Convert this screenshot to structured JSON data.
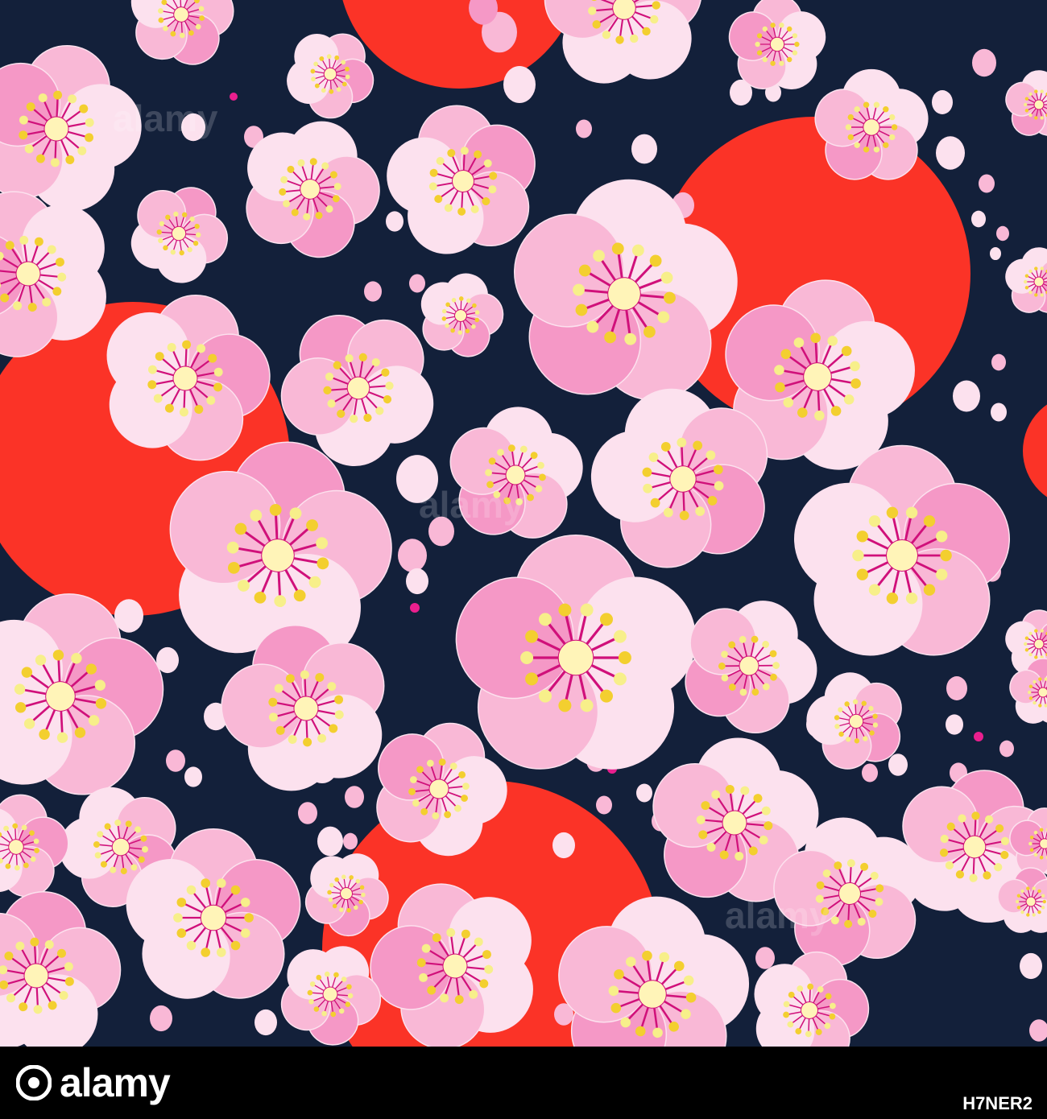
{
  "footer": {
    "brand_name": "alamy",
    "image_id": "H7NER2"
  },
  "watermark": {
    "text": "alamy"
  },
  "palette": {
    "background": "#13203a",
    "sun": "#fb3327",
    "petal_light": "#fce1ee",
    "petal_mid": "#f9b8d6",
    "petal_deep": "#f598c6",
    "center": "#fff4b8",
    "stamen": "#d0107a",
    "anther_yellow": "#f3cf2f",
    "anther_pale": "#f7ef8a",
    "dot_magenta": "#ea1f8e"
  },
  "icons": {
    "brand_mark": "alamy-logo-icon"
  }
}
